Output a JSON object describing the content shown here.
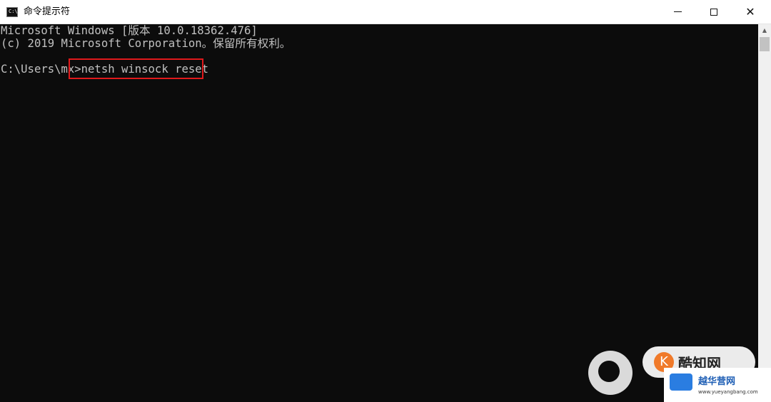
{
  "window": {
    "title": "命令提示符",
    "icon": "cmd-icon",
    "icon_text": "C:\\",
    "controls": {
      "minimize_icon": "minimize-icon",
      "maximize_icon": "maximize-icon",
      "close_icon": "close-icon",
      "close_glyph": "✕"
    }
  },
  "console": {
    "lines": [
      "Microsoft Windows [版本 10.0.18362.476]",
      "(c) 2019 Microsoft Corporation。保留所有权利。",
      "",
      "C:\\Users\\mx>netsh winsock reset"
    ],
    "highlighted_command": "netsh winsock reset",
    "highlight_color": "#e0191b"
  },
  "scrollbar": {
    "up_glyph": "▲"
  },
  "watermarks": {
    "top": {
      "logo_glyph": "K",
      "text": "酷知网"
    },
    "bottom": {
      "name": "越华营网",
      "url": "www.yueyangbang.com"
    }
  },
  "colors": {
    "console_bg": "#0c0c0c",
    "console_text": "#c0c0c0",
    "titlebar_bg": "#ffffff"
  }
}
